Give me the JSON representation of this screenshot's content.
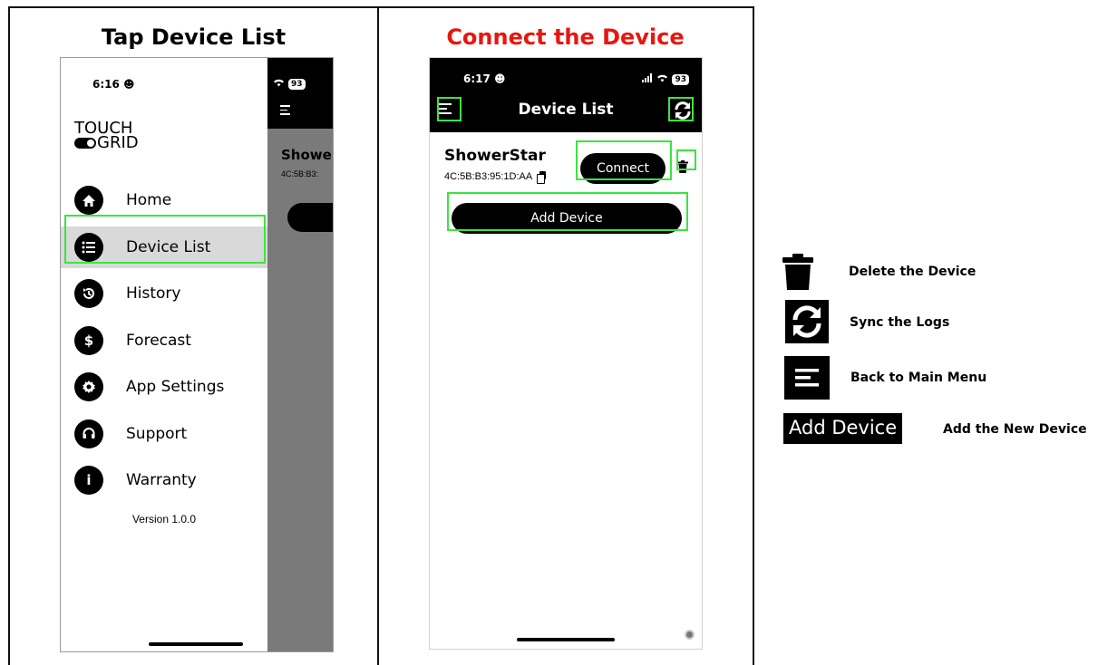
{
  "left_panel": {
    "title": "Tap Device List",
    "status_time": "6:16",
    "battery": "93",
    "logo_top": "TOUCH",
    "logo_bottom": "GRID",
    "menu": [
      {
        "label": "Home",
        "icon": "home-icon"
      },
      {
        "label": "Device List",
        "icon": "list-icon",
        "active": true
      },
      {
        "label": "History",
        "icon": "history-icon"
      },
      {
        "label": "Forecast",
        "icon": "dollar-icon"
      },
      {
        "label": "App Settings",
        "icon": "gear-icon"
      },
      {
        "label": "Support",
        "icon": "headset-icon"
      },
      {
        "label": "Warranty",
        "icon": "info-icon"
      }
    ],
    "version": "Version 1.0.0",
    "behind_device_name": "Showe",
    "behind_device_mac": "4C:5B:B3:",
    "highlight_color": "#39e63c"
  },
  "middle_panel": {
    "title": "Connect the Device",
    "title_color": "#e8160f",
    "status_time": "6:17",
    "battery": "93",
    "header_title": "Device List",
    "device_name": "ShowerStar",
    "device_mac": "4C:5B:B3:95:1D:AA",
    "connect_label": "Connect",
    "add_device_label": "Add Device"
  },
  "legend": {
    "delete": "Delete the Device",
    "sync": "Sync the Logs",
    "menu": "Back to Main Menu",
    "add_button_text": "Add Device",
    "add": "Add the New Device"
  }
}
